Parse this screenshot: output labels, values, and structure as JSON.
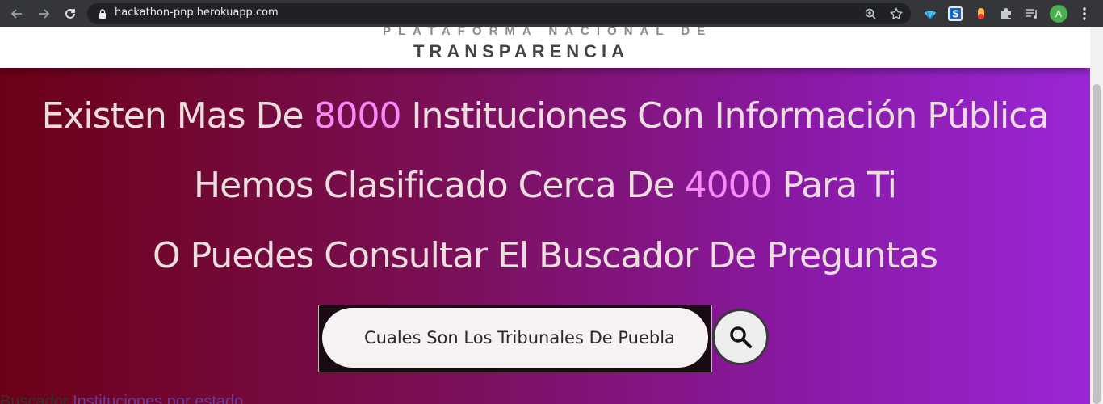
{
  "browser": {
    "url": "hackathon-pnp.herokuapp.com",
    "avatar_letter": "A"
  },
  "header": {
    "logo_top": "PLATAFORMA NACIONAL DE",
    "logo_main": "TRANSPARENCIA"
  },
  "hero": {
    "line1_before": "Existen Mas De ",
    "line1_number": "8000",
    "line1_after": " Instituciones Con Información Pública",
    "line2_before": "Hemos Clasificado Cerca De ",
    "line2_number": "4000",
    "line2_after": " Para Ti",
    "line3": "O Puedes Consultar El Buscador De Preguntas"
  },
  "search": {
    "value": "Cuales Son Los Tribunales De Puebla",
    "button_icon": "search-icon"
  },
  "footer_text": {
    "label": "Buscador",
    "link": "Instituciones por estado"
  },
  "colors": {
    "hero_gradient_start": "#6b0116",
    "hero_gradient_end": "#9a27d6",
    "highlight": "#f38cf5",
    "text": "#ecdede"
  }
}
